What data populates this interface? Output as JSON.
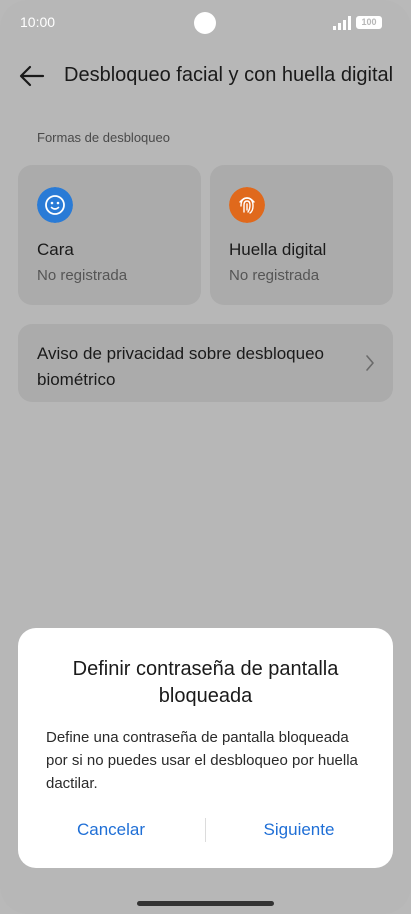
{
  "status_bar": {
    "time": "10:00",
    "battery": "100"
  },
  "header": {
    "title": "Desbloqueo facial y con huella digital",
    "back_icon": "back-arrow-icon"
  },
  "section": {
    "label": "Formas de desbloqueo"
  },
  "unlock_methods": [
    {
      "title": "Cara",
      "status": "No registrada",
      "icon": "face-icon",
      "icon_color": "#2a7bd6"
    },
    {
      "title": "Huella digital",
      "status": "No registrada",
      "icon": "fingerprint-icon",
      "icon_color": "#e0691c"
    }
  ],
  "privacy": {
    "label": "Aviso de privacidad sobre desbloqueo biométrico"
  },
  "dialog": {
    "title": "Definir contraseña de pantalla bloqueada",
    "body": "Define una contraseña de pantalla bloqueada por si no puedes usar el desbloqueo por huella dactilar.",
    "cancel_label": "Cancelar",
    "next_label": "Siguiente",
    "accent_color": "#1f6fd6"
  }
}
